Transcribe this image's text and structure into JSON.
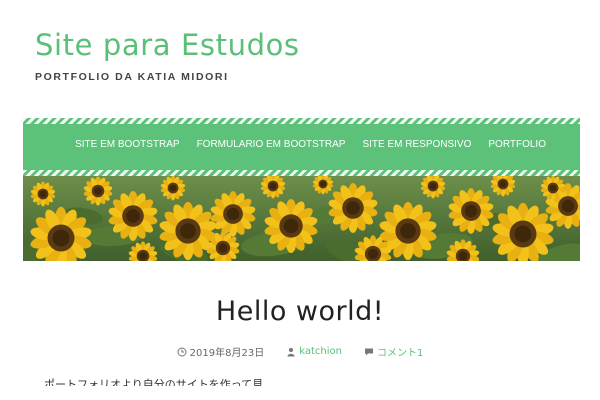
{
  "site": {
    "title": "Site para Estudos",
    "tagline": "PORTFOLIO DA KATIA MIDORI"
  },
  "colors": {
    "accent": "#5bbf77",
    "nav_background": "#5cc27a",
    "text": "#222222"
  },
  "nav": {
    "items": [
      {
        "label": "SITE EM BOOTSTRAP"
      },
      {
        "label": "FORMULARIO EM BOOTSTRAP"
      },
      {
        "label": "SITE EM RESPONSIVO"
      },
      {
        "label": "PORTFOLIO"
      }
    ]
  },
  "banner": {
    "subject": "sunflower field"
  },
  "post": {
    "title": "Hello world!",
    "date": "2019年8月23日",
    "author": "katchion",
    "comments": "コメント1",
    "excerpt": "ポートフォリオより自分のサイトを作って見"
  },
  "icons": {
    "date": "clock-icon",
    "author": "user-icon",
    "comments": "comment-icon"
  }
}
